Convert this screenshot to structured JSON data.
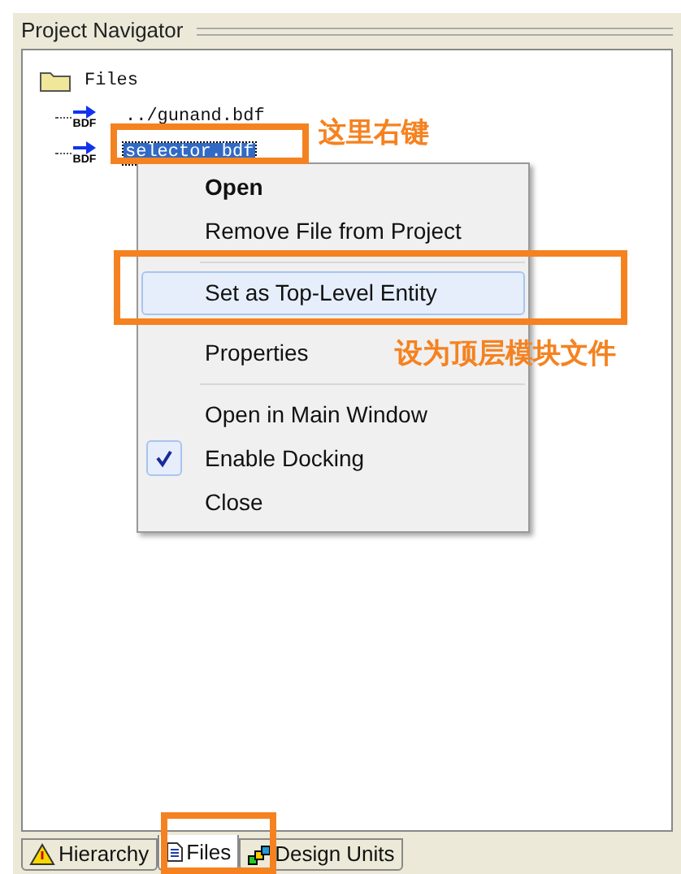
{
  "panel": {
    "title": "Project Navigator"
  },
  "tree": {
    "label": "Files",
    "expanded": true,
    "children": [
      {
        "label": "../gunand.bdf",
        "badge": "BDF",
        "selected": false
      },
      {
        "label": "selector.bdf",
        "badge": "BDF",
        "selected": true
      }
    ]
  },
  "context_menu": {
    "items": [
      {
        "kind": "item",
        "label": "Open",
        "default": true,
        "highlighted": false,
        "checked": false
      },
      {
        "kind": "item",
        "label": "Remove File from Project",
        "default": false,
        "highlighted": false,
        "checked": false
      },
      {
        "kind": "separator"
      },
      {
        "kind": "item",
        "label": "Set as Top-Level Entity",
        "default": false,
        "highlighted": true,
        "checked": false
      },
      {
        "kind": "item",
        "label": "Properties",
        "default": false,
        "highlighted": false,
        "checked": false
      },
      {
        "kind": "separator"
      },
      {
        "kind": "item",
        "label": "Open in Main Window",
        "default": false,
        "highlighted": false,
        "checked": false
      },
      {
        "kind": "item",
        "label": "Enable Docking",
        "default": false,
        "highlighted": false,
        "checked": true
      },
      {
        "kind": "item",
        "label": "Close",
        "default": false,
        "highlighted": false,
        "checked": false
      }
    ]
  },
  "annotations": [
    {
      "text": "这里右键"
    },
    {
      "text": "设为顶层模块文件"
    }
  ],
  "tabs": [
    {
      "label": "Hierarchy",
      "selected": false
    },
    {
      "label": "Files",
      "selected": true
    },
    {
      "label": "Design Units",
      "selected": false
    }
  ]
}
